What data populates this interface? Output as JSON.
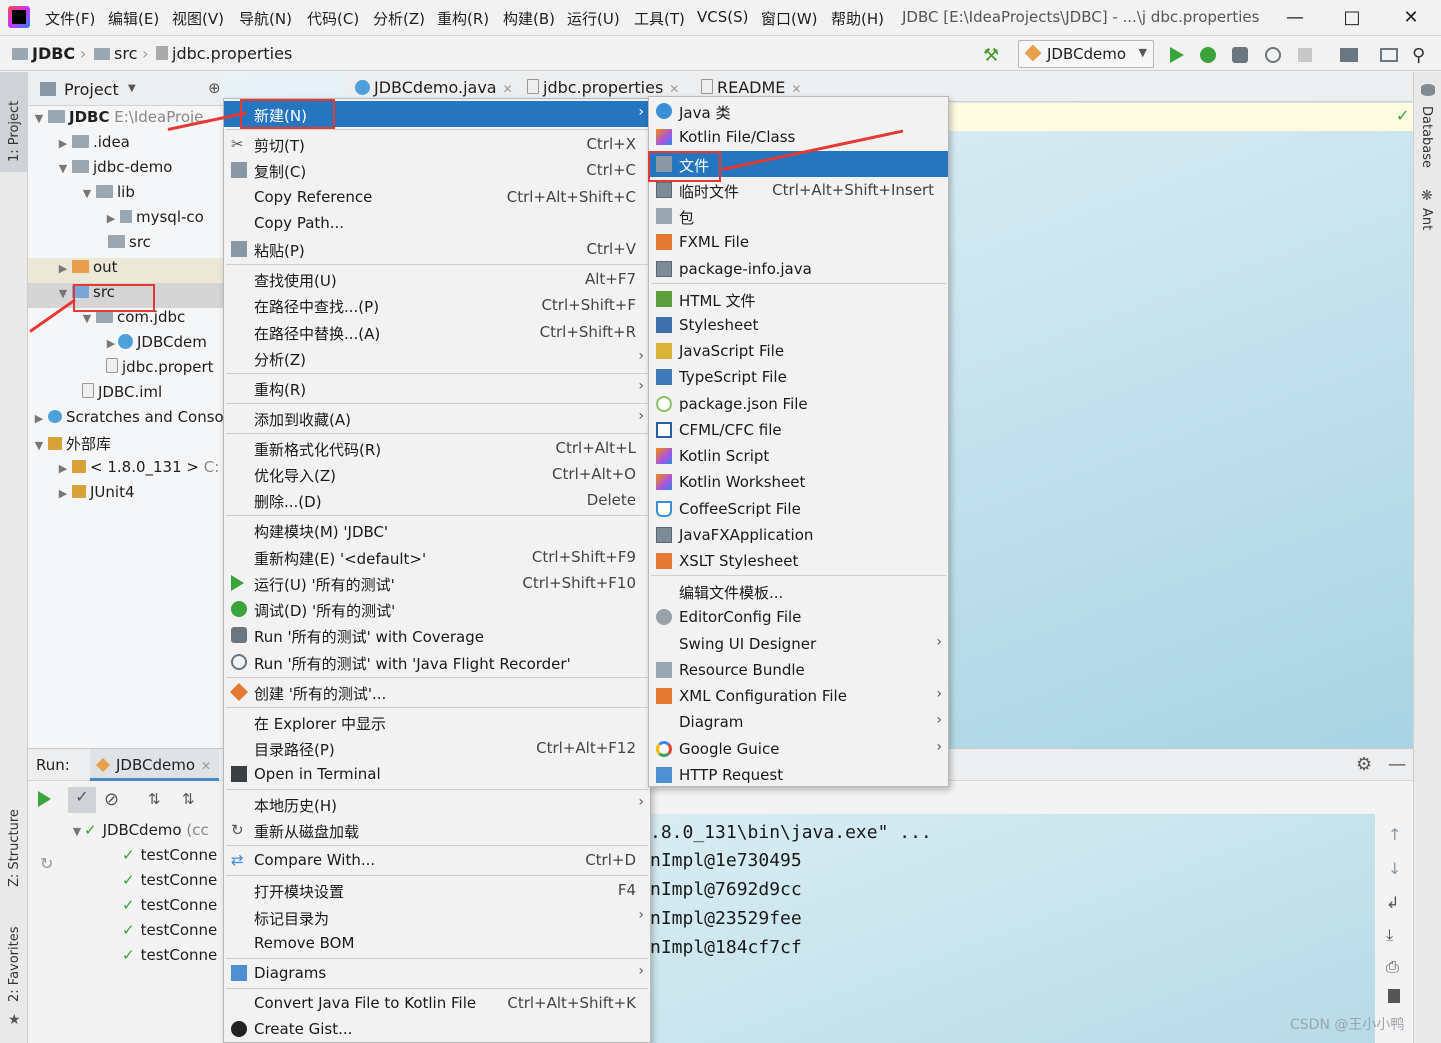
{
  "title_bar": {
    "menu": [
      "文件(F)",
      "编辑(E)",
      "视图(V)",
      "导航(N)",
      "代码(C)",
      "分析(Z)",
      "重构(R)",
      "构建(B)",
      "运行(U)",
      "工具(T)",
      "VCS(S)",
      "窗口(W)",
      "帮助(H)"
    ],
    "window_title": "JDBC [E:\\IdeaProjects\\JDBC] - ...\\j dbc.properties"
  },
  "breadcrumb": [
    "JDBC",
    "src",
    "jdbc.properties"
  ],
  "run_config": "JDBCdemo",
  "left_strip": [
    "1: Project",
    "Z: Structure",
    "2: Favorites"
  ],
  "right_strip": [
    "Database",
    "Ant"
  ],
  "project_panel": {
    "title": "Project",
    "tree": [
      {
        "label": "JDBC",
        "hint": "E:\\IdeaProje"
      },
      {
        "label": ".idea"
      },
      {
        "label": "jdbc-demo"
      },
      {
        "label": "lib"
      },
      {
        "label": "mysql-co"
      },
      {
        "label": "src"
      },
      {
        "label": "out"
      },
      {
        "label": "src"
      },
      {
        "label": "com.jdbc"
      },
      {
        "label": "JDBCdem"
      },
      {
        "label": "jdbc.propert"
      },
      {
        "label": "JDBC.iml"
      },
      {
        "label": "Scratches and Conso"
      },
      {
        "label": "外部库"
      },
      {
        "label": "< 1.8.0_131 >",
        "hint": "C:"
      },
      {
        "label": "JUnit4"
      }
    ]
  },
  "editor_tabs": [
    "JDBCdemo.java",
    "jdbc.properties",
    "README"
  ],
  "run_panel": {
    "label": "Run:",
    "tab": "JDBCdemo",
    "tree": [
      {
        "label": "JDBCdemo",
        "hint": "(cc"
      },
      {
        "label": "testConne"
      },
      {
        "label": "testConne"
      },
      {
        "label": "testConne"
      },
      {
        "label": "testConne"
      },
      {
        "label": "testConne"
      }
    ],
    "console": [
      ".8.0_131\\bin\\java.exe\" ...",
      "nImpl@1e730495",
      "nImpl@7692d9cc",
      "nImpl@23529fee",
      "nImpl@184cf7cf"
    ]
  },
  "context_menu": {
    "items": [
      {
        "label": "新建(N)",
        "shortcut": ""
      },
      {
        "label": "剪切(T)",
        "shortcut": "Ctrl+X"
      },
      {
        "label": "复制(C)",
        "shortcut": "Ctrl+C"
      },
      {
        "label": "Copy Reference",
        "shortcut": "Ctrl+Alt+Shift+C"
      },
      {
        "label": "Copy Path...",
        "shortcut": ""
      },
      {
        "label": "粘贴(P)",
        "shortcut": "Ctrl+V"
      },
      {
        "label": "查找使用(U)",
        "shortcut": "Alt+F7"
      },
      {
        "label": "在路径中查找...(P)",
        "shortcut": "Ctrl+Shift+F"
      },
      {
        "label": "在路径中替换...(A)",
        "shortcut": "Ctrl+Shift+R"
      },
      {
        "label": "分析(Z)",
        "shortcut": ""
      },
      {
        "label": "重构(R)",
        "shortcut": ""
      },
      {
        "label": "添加到收藏(A)",
        "shortcut": ""
      },
      {
        "label": "重新格式化代码(R)",
        "shortcut": "Ctrl+Alt+L"
      },
      {
        "label": "优化导入(Z)",
        "shortcut": "Ctrl+Alt+O"
      },
      {
        "label": "删除...(D)",
        "shortcut": "Delete"
      },
      {
        "label": "构建模块(M) 'JDBC'",
        "shortcut": ""
      },
      {
        "label": "重新构建(E) '<default>'",
        "shortcut": "Ctrl+Shift+F9"
      },
      {
        "label": "运行(U) '所有的测试'",
        "shortcut": "Ctrl+Shift+F10"
      },
      {
        "label": "调试(D) '所有的测试'",
        "shortcut": ""
      },
      {
        "label": "Run '所有的测试' with Coverage",
        "shortcut": ""
      },
      {
        "label": "Run '所有的测试' with 'Java Flight Recorder'",
        "shortcut": ""
      },
      {
        "label": "创建 '所有的测试'...",
        "shortcut": ""
      },
      {
        "label": "在 Explorer 中显示",
        "shortcut": ""
      },
      {
        "label": "目录路径(P)",
        "shortcut": "Ctrl+Alt+F12"
      },
      {
        "label": "Open in Terminal",
        "shortcut": ""
      },
      {
        "label": "本地历史(H)",
        "shortcut": ""
      },
      {
        "label": "重新从磁盘加载",
        "shortcut": ""
      },
      {
        "label": "Compare With...",
        "shortcut": "Ctrl+D"
      },
      {
        "label": "打开模块设置",
        "shortcut": "F4"
      },
      {
        "label": "标记目录为",
        "shortcut": ""
      },
      {
        "label": "Remove BOM",
        "shortcut": ""
      },
      {
        "label": "Diagrams",
        "shortcut": ""
      },
      {
        "label": "Convert Java File to Kotlin File",
        "shortcut": "Ctrl+Alt+Shift+K"
      },
      {
        "label": "Create Gist...",
        "shortcut": ""
      }
    ]
  },
  "new_submenu": {
    "items": [
      {
        "label": "Java 类",
        "shortcut": ""
      },
      {
        "label": "Kotlin File/Class",
        "shortcut": ""
      },
      {
        "label": "文件",
        "shortcut": ""
      },
      {
        "label": "临时文件",
        "shortcut": "Ctrl+Alt+Shift+Insert"
      },
      {
        "label": "包",
        "shortcut": ""
      },
      {
        "label": "FXML File",
        "shortcut": ""
      },
      {
        "label": "package-info.java",
        "shortcut": ""
      },
      {
        "label": "HTML 文件",
        "shortcut": ""
      },
      {
        "label": "Stylesheet",
        "shortcut": ""
      },
      {
        "label": "JavaScript File",
        "shortcut": ""
      },
      {
        "label": "TypeScript File",
        "shortcut": ""
      },
      {
        "label": "package.json File",
        "shortcut": ""
      },
      {
        "label": "CFML/CFC file",
        "shortcut": ""
      },
      {
        "label": "Kotlin Script",
        "shortcut": ""
      },
      {
        "label": "Kotlin Worksheet",
        "shortcut": ""
      },
      {
        "label": "CoffeeScript File",
        "shortcut": ""
      },
      {
        "label": "JavaFXApplication",
        "shortcut": ""
      },
      {
        "label": "XSLT Stylesheet",
        "shortcut": ""
      },
      {
        "label": "编辑文件模板...",
        "shortcut": ""
      },
      {
        "label": "EditorConfig File",
        "shortcut": ""
      },
      {
        "label": "Swing UI Designer",
        "shortcut": ""
      },
      {
        "label": "Resource Bundle",
        "shortcut": ""
      },
      {
        "label": "XML Configuration File",
        "shortcut": ""
      },
      {
        "label": "Diagram",
        "shortcut": ""
      },
      {
        "label": "Google Guice",
        "shortcut": ""
      },
      {
        "label": "HTTP Request",
        "shortcut": ""
      }
    ]
  },
  "watermark": "CSDN @王小小鸭"
}
